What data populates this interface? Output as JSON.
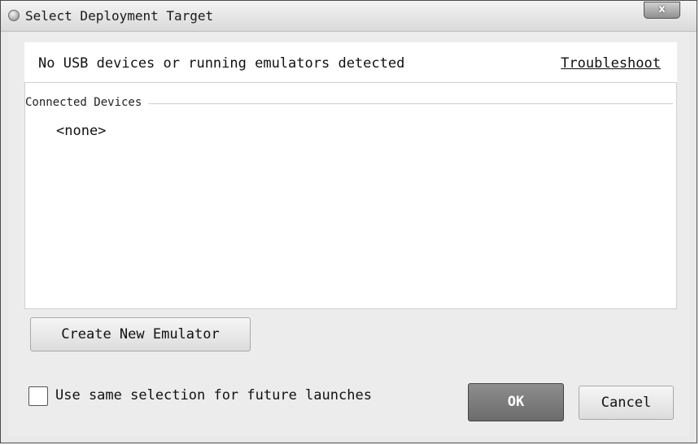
{
  "window": {
    "title": "Select Deployment Target",
    "close_label": "x"
  },
  "info": {
    "message": "No USB devices or running emulators detected",
    "troubleshoot_link": "Troubleshoot"
  },
  "devices": {
    "group_label": "Connected Devices",
    "items": [
      "<none>"
    ]
  },
  "buttons": {
    "create_emulator": "Create New Emulator",
    "ok": "OK",
    "cancel": "Cancel"
  },
  "options": {
    "same_selection_label": "Use same selection for future launches",
    "same_selection_checked": false
  }
}
